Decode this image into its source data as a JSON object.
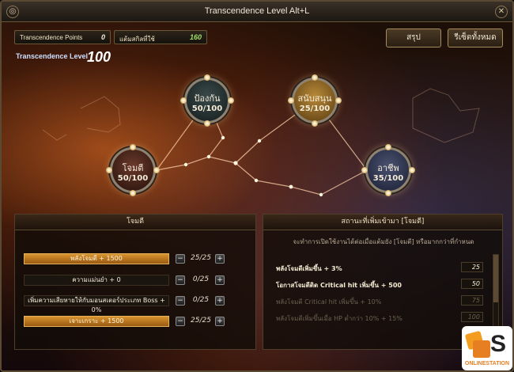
{
  "window": {
    "title": "Transcendence Level Alt+L"
  },
  "icons": {
    "corner": "swirl-icon",
    "close": "close-icon"
  },
  "stats": {
    "points_label": "Transcendence Points",
    "points_value": "0",
    "used_label": "แต้มสกิลที่ใช้",
    "used_value": "160"
  },
  "buttons": {
    "summary": "สรุป",
    "reset": "รีเซ็ตทั้งหมด"
  },
  "level": {
    "label": "Transcendence Level",
    "value": "100"
  },
  "nodes": [
    {
      "name": "ป้องกัน",
      "value": "50/100"
    },
    {
      "name": "สนับสนุน",
      "value": "25/100"
    },
    {
      "name": "โจมตี",
      "value": "50/100"
    },
    {
      "name": "อาชีพ",
      "value": "35/100"
    }
  ],
  "left_panel": {
    "title": "โจมตี",
    "skills": [
      {
        "label": "พลังโจมตี + 1500",
        "count": "25/25",
        "active": true
      },
      {
        "label": "ความแม่นยำ + 0",
        "count": "0/25",
        "active": false
      },
      {
        "label": "เพิ่มความเสียหายให้กับมอนสเตอร์ประเภท Boss + 0%",
        "count": "0/25",
        "active": false
      },
      {
        "label": "เจาะเกราะ + 1500",
        "count": "25/25",
        "active": true
      }
    ]
  },
  "right_panel": {
    "title": "สถานะที่เพิ่มเข้ามา [โจมตี]",
    "description": "จะทำการเปิดใช้งานได้ต่อเมื่อแต้มยัง [โจมตี] หรือมากกว่าที่กำหนด",
    "lines": [
      {
        "text": "พลังโจมตีเพิ่มขึ้น + 3%",
        "value": "25",
        "on": true
      },
      {
        "text": "โอกาสโจมตีติด Critical hit เพิ่มขึ้น + 500",
        "value": "50",
        "on": true
      },
      {
        "text": "พลังโจมตี Critical hit เพิ่มขึ้น + 10%",
        "value": "75",
        "on": false
      },
      {
        "text": "พลังโจมตีเพิ่มขึ้นเมื่อ HP ต่ำกว่า 10% + 15%",
        "value": "100",
        "on": false
      }
    ]
  },
  "watermark": {
    "letter": "S",
    "text": "ONLINESTATION"
  }
}
